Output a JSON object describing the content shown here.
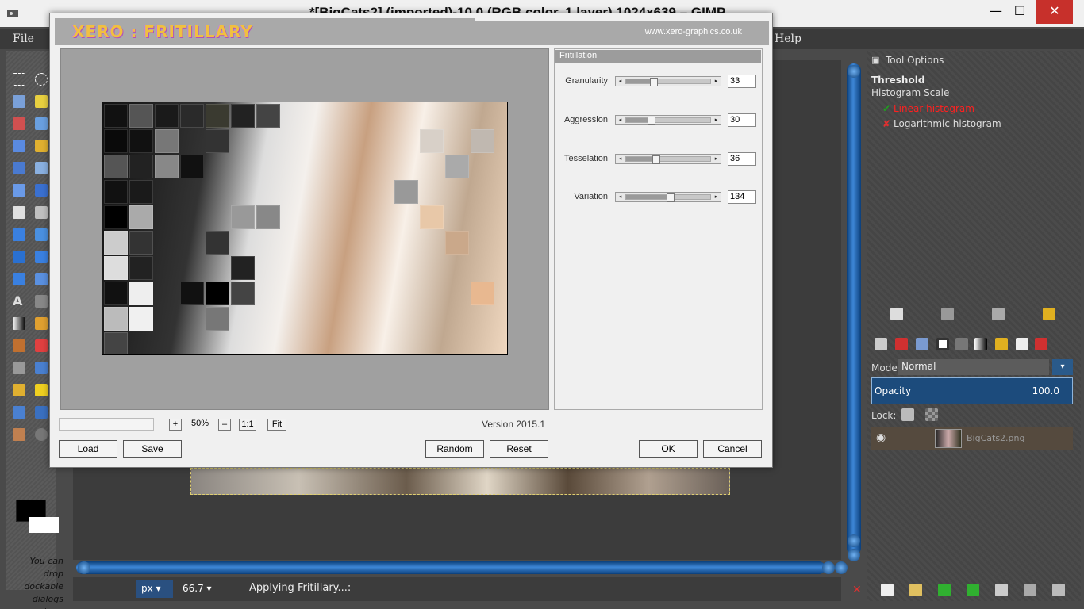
{
  "window": {
    "title": "*[BigCats2] (imported)-10.0 (RGB color, 1 layer) 1024x639 – GIMP",
    "minimize": "—",
    "maximize": "☐",
    "close": "✕"
  },
  "menubar": {
    "file": "File",
    "help": "Help"
  },
  "dropnote": "You can drop dockable dialogs here",
  "statusbar": {
    "unit": "px",
    "zoom": "66.7",
    "message": "Applying Fritillary...:"
  },
  "dock": {
    "title": "Tool Options",
    "tool_name": "Threshold",
    "histogram_scale": "Histogram Scale",
    "linear": "Linear histogram",
    "logarithmic": "Logarithmic histogram",
    "mode_label": "Mode:",
    "mode_value": "Normal",
    "opacity_label": "Opacity",
    "opacity_value": "100.0",
    "lock_label": "Lock:",
    "layer_name": "BigCats2.png",
    "colors": {
      "linear": "#ff2020",
      "check": "#1fa01f",
      "cross": "#e03030"
    }
  },
  "dialog": {
    "logo": "XERO : FRITILLARY",
    "url": "www.xero-graphics.co.uk",
    "panel_title": "Fritillation",
    "params": [
      {
        "label": "Granularity",
        "value": "33"
      },
      {
        "label": "Aggression",
        "value": "30"
      },
      {
        "label": "Tesselation",
        "value": "36"
      },
      {
        "label": "Variation",
        "value": "134"
      }
    ],
    "zoom_in": "+",
    "zoom_value": "50%",
    "zoom_out": "–",
    "zoom_1to1": "1:1",
    "zoom_fit": "Fit",
    "version": "Version 2015.1",
    "load": "Load",
    "save": "Save",
    "random": "Random",
    "reset": "Reset",
    "ok": "OK",
    "cancel": "Cancel"
  }
}
